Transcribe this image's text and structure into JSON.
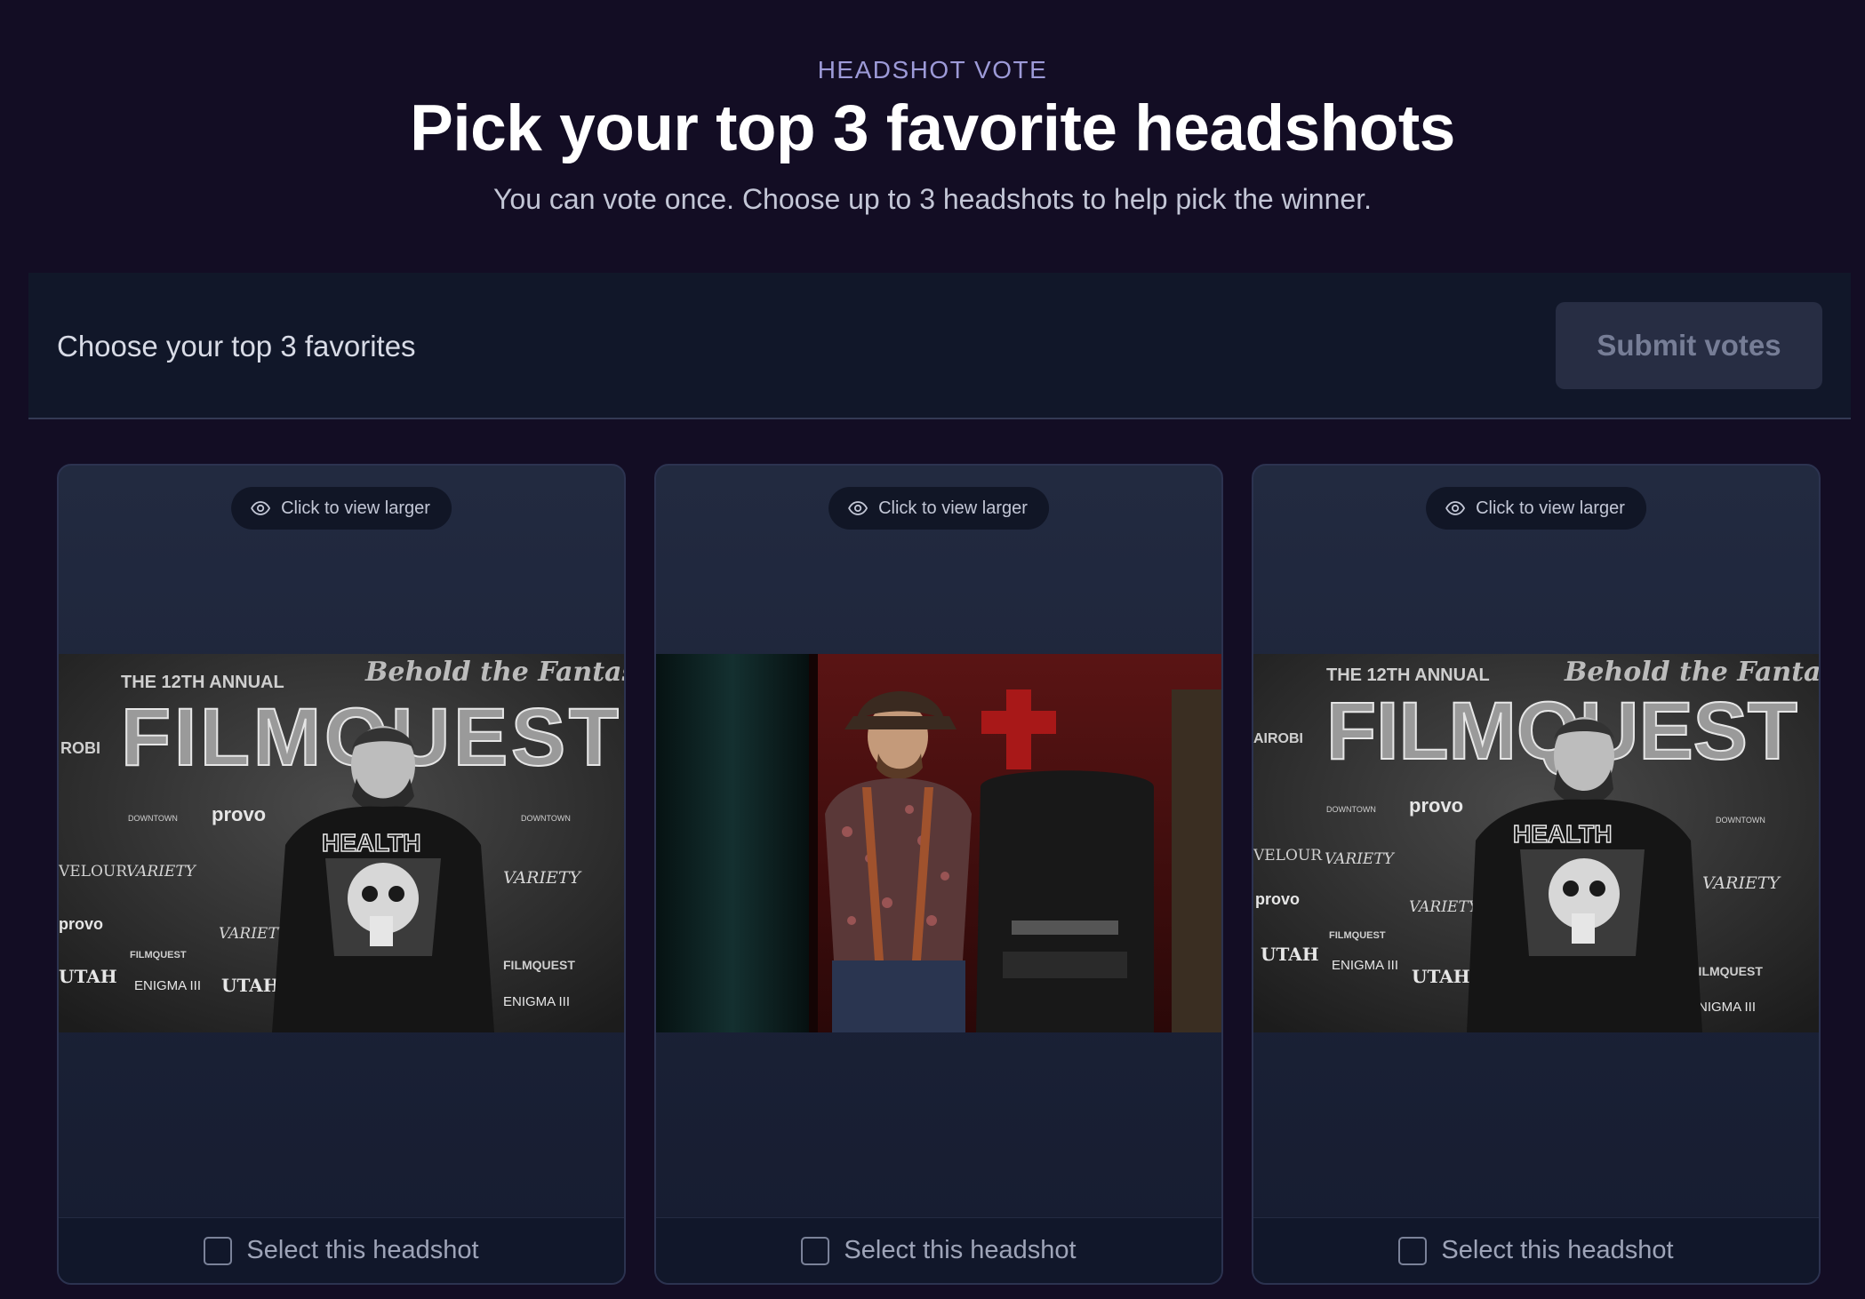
{
  "header": {
    "eyebrow": "HEADSHOT VOTE",
    "title": "Pick your top 3 favorite headshots",
    "subtitle": "You can vote once. Choose up to 3 headshots to help pick the winner."
  },
  "actionbar": {
    "label": "Choose your top 3 favorites",
    "submit_label": "Submit votes"
  },
  "cards": [
    {
      "view_label": "Click to view larger",
      "select_label": "Select this headshot",
      "selected": false,
      "photo": {
        "style": "black-and-white",
        "backdrop_text": [
          "THE 12TH ANNUAL",
          "Behold the Fantastic",
          "FILMQUEST"
        ],
        "sponsor_text": [
          "provo",
          "VARIETY",
          "UTAH",
          "ENIGMA III",
          "VELOUR",
          "DOWNTOWN",
          "FILMQUEST",
          "ROBI"
        ]
      }
    },
    {
      "view_label": "Click to view larger",
      "select_label": "Select this headshot",
      "selected": false,
      "photo": {
        "style": "color"
      }
    },
    {
      "view_label": "Click to view larger",
      "select_label": "Select this headshot",
      "selected": false,
      "photo": {
        "style": "black-and-white",
        "backdrop_text": [
          "THE 12TH ANNUAL",
          "Behold the Fantastic",
          "FILMQUEST"
        ],
        "sponsor_text": [
          "provo",
          "VARIETY",
          "UTAH",
          "ENIGMA III",
          "VELOUR",
          "DOWNTOWN",
          "FILMQUEST",
          "AIROBI"
        ]
      }
    }
  ],
  "colors": {
    "page_bg": "#130d24",
    "panel_bg": "#111729",
    "card_bg": "#1e2539",
    "accent_eyebrow": "#9d9ad8",
    "button_disabled_bg": "#272d43",
    "button_disabled_text": "#767d96"
  },
  "icons": {
    "view": "eye-icon",
    "select": "checkbox-icon"
  }
}
